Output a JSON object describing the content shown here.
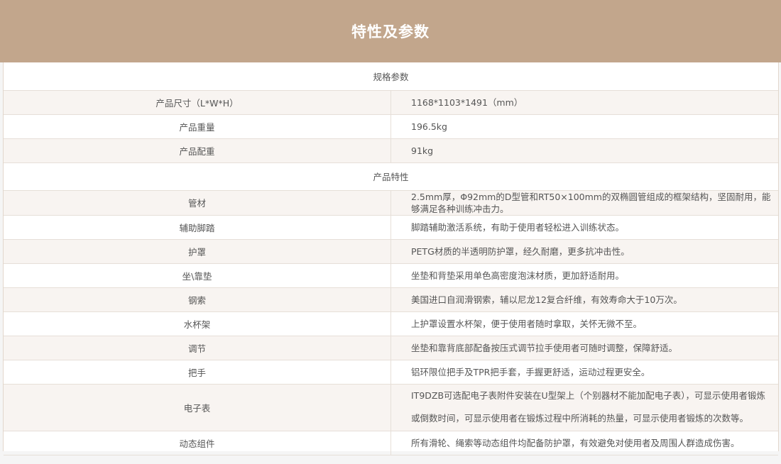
{
  "header": {
    "title": "特性及参数"
  },
  "specs": {
    "section_title": "规格参数",
    "rows": [
      {
        "label": "产品尺寸（L*W*H）",
        "value": "1168*1103*1491（mm）"
      },
      {
        "label": "产品重量",
        "value": "196.5kg"
      },
      {
        "label": "产品配重",
        "value": "91kg"
      }
    ]
  },
  "features": {
    "section_title": "产品特性",
    "rows": [
      {
        "label": "管材",
        "value": "2.5mm厚，Φ92mm的D型管和RT50×100mm的双椭圆管组成的框架结构，坚固耐用，能够满足各种训练冲击力。"
      },
      {
        "label": "辅助脚踏",
        "value": "脚踏辅助激活系统，有助于使用者轻松进入训练状态。"
      },
      {
        "label": "护罩",
        "value": "PETG材质的半透明防护罩，经久耐磨，更多抗冲击性。"
      },
      {
        "label": "坐\\靠垫",
        "value": "坐垫和背垫采用单色高密度泡沫材质，更加舒适耐用。"
      },
      {
        "label": "钢索",
        "value": "美国进口自润滑钢索，辅以尼龙12复合纤维，有效寿命大于10万次。"
      },
      {
        "label": "水杯架",
        "value": "上护罩设置水杯架，便于使用者随时拿取，关怀无微不至。"
      },
      {
        "label": "调节",
        "value": "坐垫和靠背底部配备按压式调节拉手使用者可随时调整，保障舒适。"
      },
      {
        "label": "把手",
        "value": "铝环限位把手及TPR把手套，手握更舒适，运动过程更安全。"
      },
      {
        "label": "电子表",
        "value": "IT9DZB可选配电子表附件安装在U型架上（个别器材不能加配电子表），可显示使用者锻炼或倒数时间，可显示使用者在锻炼过程中所消耗的热量，可显示使用者锻炼的次数等。"
      },
      {
        "label": "动态组件",
        "value": "所有滑轮、绳索等动态组件均配备防护罩，有效避免对使用者及周围人群造成伤害。"
      }
    ]
  }
}
